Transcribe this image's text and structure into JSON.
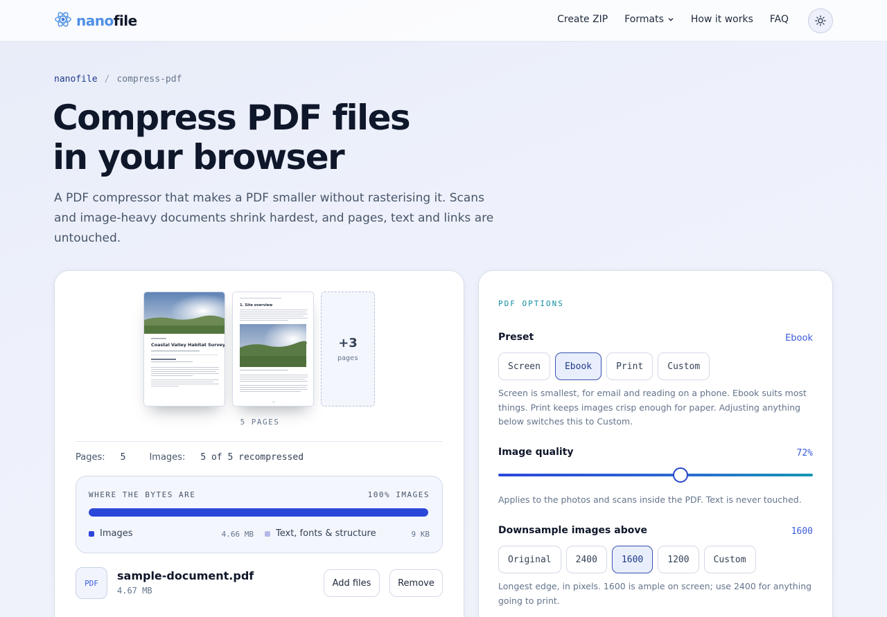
{
  "header": {
    "logo_part1": "nano",
    "logo_part2": "file",
    "nav": [
      {
        "label": "Create ZIP"
      },
      {
        "label": "Formats"
      },
      {
        "label": "How it works"
      },
      {
        "label": "FAQ"
      }
    ]
  },
  "breadcrumb": {
    "home": "nanofile",
    "sep": "/",
    "current": "compress-pdf"
  },
  "hero": {
    "title_line1": "Compress PDF files",
    "title_line2": "in your browser",
    "description": "A PDF compressor that makes a PDF smaller without rasterising it. Scans and image-heavy documents shrink hardest, and pages, text and links are untouched."
  },
  "preview": {
    "page1_title": "Coastal Valley Habitat Survey",
    "page2_heading": "1. Site overview",
    "more_count": "+3",
    "more_label": "pages",
    "pages_label": "5 PAGES"
  },
  "stats": {
    "pages_label": "Pages:",
    "pages_value": "5",
    "images_label": "Images:",
    "images_value": "5 of 5 recompressed"
  },
  "bytes": {
    "title": "WHERE THE BYTES ARE",
    "percent_label": "100% IMAGES",
    "images_fraction": 1.0,
    "legend": [
      {
        "label": "Images",
        "size": "4.66 MB",
        "color": "#2b47d9"
      },
      {
        "label": "Text, fonts & structure",
        "size": "9 KB",
        "color": "#b4b9ea"
      }
    ]
  },
  "file": {
    "icon_label": "PDF",
    "name": "sample-document.pdf",
    "size": "4.67 MB",
    "add_label": "Add files",
    "remove_label": "Remove"
  },
  "options": {
    "section_title": "PDF OPTIONS",
    "preset": {
      "label": "Preset",
      "value": "Ebook",
      "choices": [
        "Screen",
        "Ebook",
        "Print",
        "Custom"
      ],
      "selected": "Ebook",
      "help": "Screen is smallest, for email and reading on a phone. Ebook suits most things. Print keeps images crisp enough for paper. Adjusting anything below switches this to Custom."
    },
    "quality": {
      "label": "Image quality",
      "value": "72%",
      "fraction": 0.58,
      "help": "Applies to the photos and scans inside the PDF. Text is never touched."
    },
    "downsample": {
      "label": "Downsample images above",
      "value": "1600",
      "choices": [
        "Original",
        "2400",
        "1600",
        "1200",
        "Custom"
      ],
      "selected": "1600",
      "help": "Longest edge, in pixels. 1600 is ample on screen; use 2400 for anything going to print."
    }
  }
}
